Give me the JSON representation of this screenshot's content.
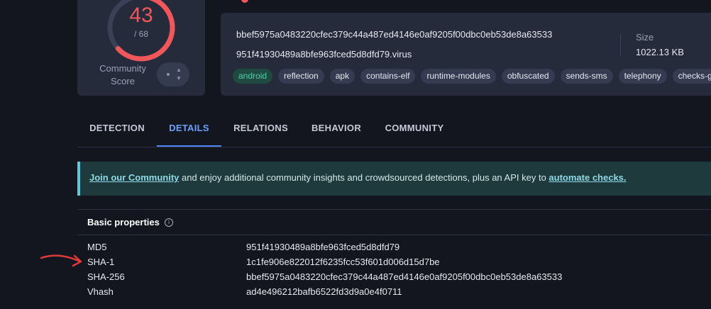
{
  "score": {
    "detections": "43",
    "total": "/ 68",
    "detected_fraction": 0.632,
    "community_label": "Community Score"
  },
  "file": {
    "sha256": "bbef5975a0483220cfec379c44a487ed4146e0af9205f00dbc0eb53de8a63533",
    "name": "951f41930489a8bfe963fced5d8dfd79.virus",
    "size_label": "Size",
    "size_value": "1022.13 KB",
    "tags": [
      "android",
      "reflection",
      "apk",
      "contains-elf",
      "runtime-modules",
      "obfuscated",
      "sends-sms",
      "telephony",
      "checks-gps"
    ]
  },
  "tabs": [
    "DETECTION",
    "DETAILS",
    "RELATIONS",
    "BEHAVIOR",
    "COMMUNITY"
  ],
  "active_tab": "DETAILS",
  "banner": {
    "link1": "Join our Community",
    "middle": " and enjoy additional community insights and crowdsourced detections, plus an API key to ",
    "link2": "automate checks."
  },
  "properties": {
    "title": "Basic properties",
    "rows": [
      {
        "key": "MD5",
        "value": "951f41930489a8bfe963fced5d8dfd79"
      },
      {
        "key": "SHA-1",
        "value": "1c1fe906e822012f6235fcc53f601d006d15d7be"
      },
      {
        "key": "SHA-256",
        "value": "bbef5975a0483220cfec379c44a487ed4146e0af9205f00dbc0eb53de8a63533"
      },
      {
        "key": "Vhash",
        "value": "ad4e496212bafb6522fd3d9a0e4f0711"
      }
    ]
  },
  "colors": {
    "accent_red": "#f0565a",
    "accent_blue": "#4f86f7",
    "tag_green": "#4fd1a5",
    "banner_accent": "#5fc7d6"
  }
}
